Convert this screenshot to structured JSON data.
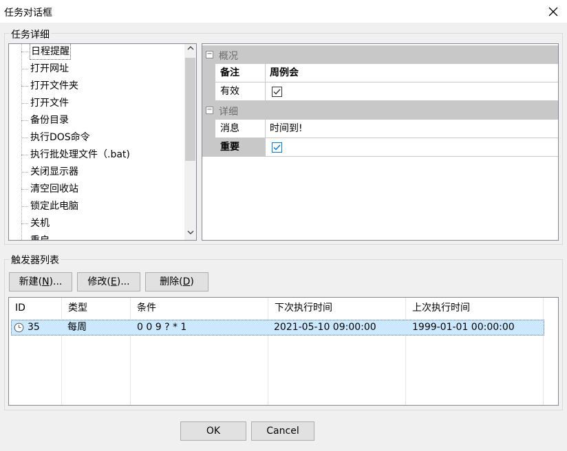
{
  "window": {
    "title": "任务对话框",
    "close_icon": "close-icon"
  },
  "details_group": {
    "title": "任务详细"
  },
  "tree": {
    "items": [
      "日程提醒",
      "打开网址",
      "打开文件夹",
      "打开文件",
      "备份目录",
      "执行DOS命令",
      "执行批处理文件（.bat)",
      "关闭显示器",
      "清空回收站",
      "锁定此电脑",
      "关机",
      "重启"
    ],
    "selected_index": 0,
    "scroll_up": "^",
    "scroll_down": "v"
  },
  "properties": {
    "category1": {
      "toggle": "⊟",
      "label": "概况"
    },
    "note": {
      "name": "备注",
      "value": "周例会"
    },
    "enabled": {
      "name": "有效",
      "checked": true
    },
    "category2": {
      "toggle": "⊟",
      "label": "详细"
    },
    "message": {
      "name": "消息",
      "value": "时间到!"
    },
    "important": {
      "name": "重要",
      "checked": true
    }
  },
  "triggers_group": {
    "title": "触发器列表"
  },
  "trigger_buttons": {
    "new": {
      "pre": "新建(",
      "key": "N",
      "post": ")..."
    },
    "edit": {
      "pre": "修改(",
      "key": "E",
      "post": ")..."
    },
    "delete": {
      "pre": "删除(",
      "key": "D",
      "post": ")"
    }
  },
  "trigger_list": {
    "columns": [
      "ID",
      "类型",
      "条件",
      "下次执行时间",
      "上次执行时间"
    ],
    "rows": [
      {
        "icon": "clock-icon",
        "id": "35",
        "type": "每周",
        "condition": "0 0 9 ? * 1",
        "next_run": "2021-05-10 09:00:00",
        "last_run": "1999-01-01 00:00:00"
      }
    ]
  },
  "dialog_buttons": {
    "ok": "OK",
    "cancel": "Cancel"
  },
  "colors": {
    "selection": "#cce8ff",
    "checkbox_blue": "#0078d7",
    "category_bg": "#c8c8c8"
  }
}
